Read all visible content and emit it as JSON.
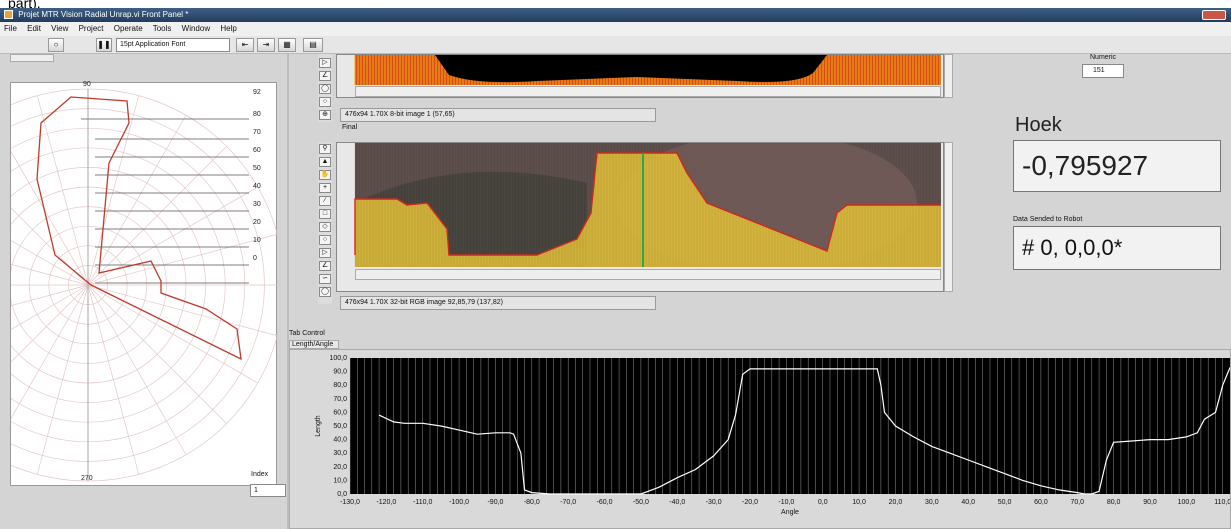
{
  "crop_text": "part).",
  "window": {
    "title": "Projet MTR Vision Radial Unrap.vi Front Panel *"
  },
  "menu": [
    "File",
    "Edit",
    "View",
    "Project",
    "Operate",
    "Tools",
    "Window",
    "Help"
  ],
  "toolbar": {
    "font": "15pt Application Font"
  },
  "polar": {
    "label_90": "90",
    "label_270": "270",
    "radial_labels": [
      "92",
      "80",
      "70",
      "60",
      "50",
      "40",
      "30",
      "20",
      "10",
      "0"
    ]
  },
  "image1": {
    "info": "476x94 1.70X 8-bit image 1   (57,65)"
  },
  "image2": {
    "caption": "Final",
    "info": "476x94 1.70X 32-bit RGB image 92,85,79   (137,82)"
  },
  "numeric": {
    "label": "Numeric",
    "value": "151"
  },
  "hoek": {
    "label": "Hoek",
    "value": "-0,795927"
  },
  "robot": {
    "label": "Data Sended to Robot",
    "value": "#  0,  0,0,0*"
  },
  "tab": {
    "label": "Tab Control",
    "page": "Length/Angle"
  },
  "index": {
    "label": "Index",
    "value": "1"
  },
  "chart_data": {
    "type": "line",
    "xlabel": "Angle",
    "ylabel": "Length",
    "xlim": [
      -130,
      112
    ],
    "ylim": [
      0,
      100
    ],
    "x_ticks": [
      "-130,0",
      "-120,0",
      "-110,0",
      "-100,0",
      "-90,0",
      "-80,0",
      "-70,0",
      "-60,0",
      "-50,0",
      "-40,0",
      "-30,0",
      "-20,0",
      "-10,0",
      "0,0",
      "10,0",
      "20,0",
      "30,0",
      "40,0",
      "50,0",
      "60,0",
      "70,0",
      "80,0",
      "90,0",
      "100,0",
      "110,0"
    ],
    "y_ticks": [
      "0,0",
      "10,0",
      "20,0",
      "30,0",
      "40,0",
      "50,0",
      "60,0",
      "70,0",
      "80,0",
      "90,0",
      "100,0"
    ],
    "series": [
      {
        "x": [
          -122,
          -118,
          -115,
          -110,
          -105,
          -100,
          -95,
          -90,
          -86,
          -85,
          -83,
          -82,
          -80,
          -75,
          -60,
          -50,
          -48,
          -45,
          -40,
          -35,
          -30,
          -26,
          -24,
          -22,
          -20,
          -18,
          -16,
          -10,
          0,
          10,
          15,
          16,
          17,
          20,
          25,
          30,
          35,
          40,
          45,
          50,
          55,
          60,
          65,
          70,
          72,
          74,
          76,
          78,
          80,
          85,
          90,
          95,
          100,
          103,
          105,
          108,
          110,
          112
        ],
        "y": [
          58,
          53,
          52,
          52,
          50,
          47,
          44,
          45,
          45,
          44,
          30,
          3,
          1,
          0,
          0,
          0,
          2,
          5,
          12,
          18,
          28,
          40,
          58,
          88,
          92,
          92,
          92,
          92,
          92,
          92,
          92,
          80,
          60,
          50,
          42,
          35,
          30,
          25,
          20,
          15,
          10,
          6,
          3,
          1,
          0,
          0,
          2,
          25,
          38,
          39,
          40,
          40,
          42,
          45,
          55,
          60,
          80,
          93
        ]
      }
    ]
  }
}
